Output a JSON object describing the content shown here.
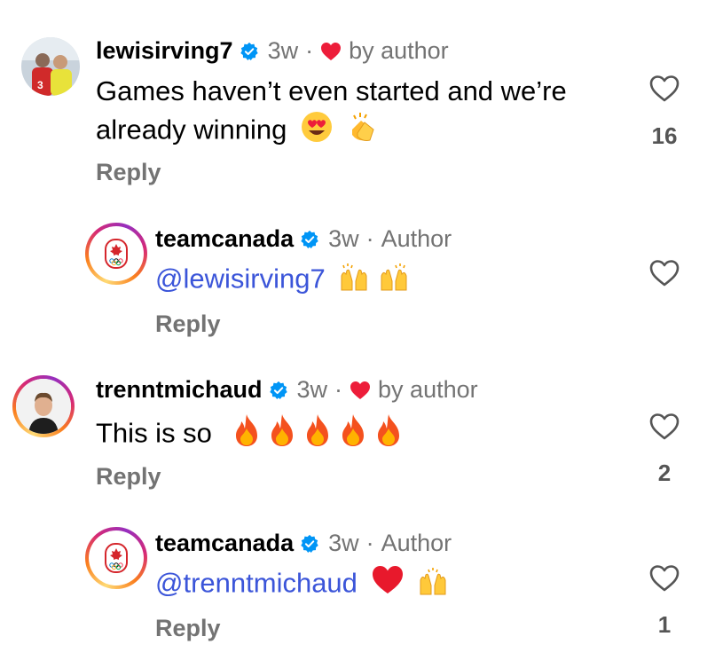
{
  "comments": [
    {
      "username": "lewisirving7",
      "time": "3w",
      "liked_label": "by author",
      "text": "Games haven’t even started and we’re already winning",
      "reply": "Reply",
      "likes": "16"
    },
    {
      "username": "teamcanada",
      "time": "3w",
      "role": "Author",
      "mention": "@lewisirving7",
      "reply": "Reply",
      "likes": ""
    },
    {
      "username": "trenntmichaud",
      "time": "3w",
      "liked_label": "by author",
      "text": "This is so",
      "reply": "Reply",
      "likes": "2"
    },
    {
      "username": "teamcanada",
      "time": "3w",
      "role": "Author",
      "mention": "@trenntmichaud",
      "reply": "Reply",
      "likes": "1"
    }
  ],
  "colors": {
    "text": "#000000",
    "secondary": "#737373",
    "mention": "#3b55d9",
    "verified": "#0095f6",
    "heart": "#ed1d3a"
  },
  "icons": [
    "verified-badge-icon",
    "heart-icon",
    "like-outline-icon",
    "heart-eyes-emoji",
    "clapping-emoji",
    "raised-hands-emoji",
    "fire-emoji",
    "red-heart-emoji",
    "team-canada-logo"
  ]
}
